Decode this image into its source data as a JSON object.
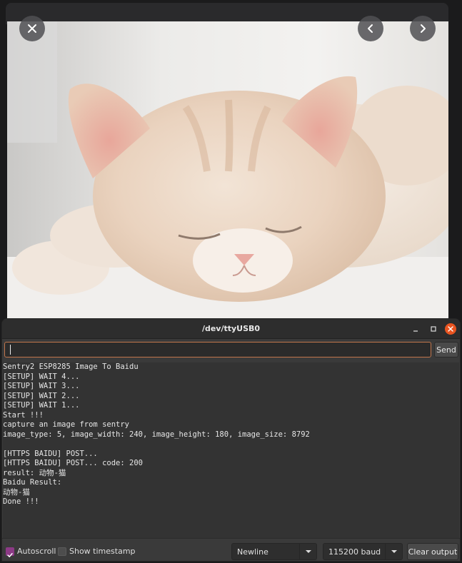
{
  "serial_monitor": {
    "title": "/dev/ttyUSB0",
    "input": {
      "value": "",
      "placeholder": ""
    },
    "send_label": "Send",
    "output_lines": [
      "Sentry2 ESP8285 Image To Baidu",
      "[SETUP] WAIT 4...",
      "[SETUP] WAIT 3...",
      "[SETUP] WAIT 2...",
      "[SETUP] WAIT 1...",
      "Start !!!",
      "capture an image from sentry",
      "image_type: 5, image_width: 240, image_height: 180, image_size: 8792",
      "",
      "[HTTPS BAIDU] POST...",
      "[HTTPS BAIDU] POST... code: 200",
      "result: 动物-猫",
      "Baidu Result:",
      "动物-猫",
      "Done !!!"
    ],
    "footer": {
      "autoscroll": {
        "label": "Autoscroll",
        "checked": true
      },
      "timestamp": {
        "label": "Show timestamp",
        "checked": false
      },
      "line_ending": "Newline",
      "baud": "115200 baud",
      "clear_label": "Clear output"
    }
  },
  "image_viewer": {
    "icons": [
      "close-icon",
      "chevron-left-icon",
      "chevron-right-icon"
    ]
  },
  "colors": {
    "accent_close": "#e95420",
    "input_border": "#c2764c",
    "checkbox_checked": "#8c3a86"
  }
}
